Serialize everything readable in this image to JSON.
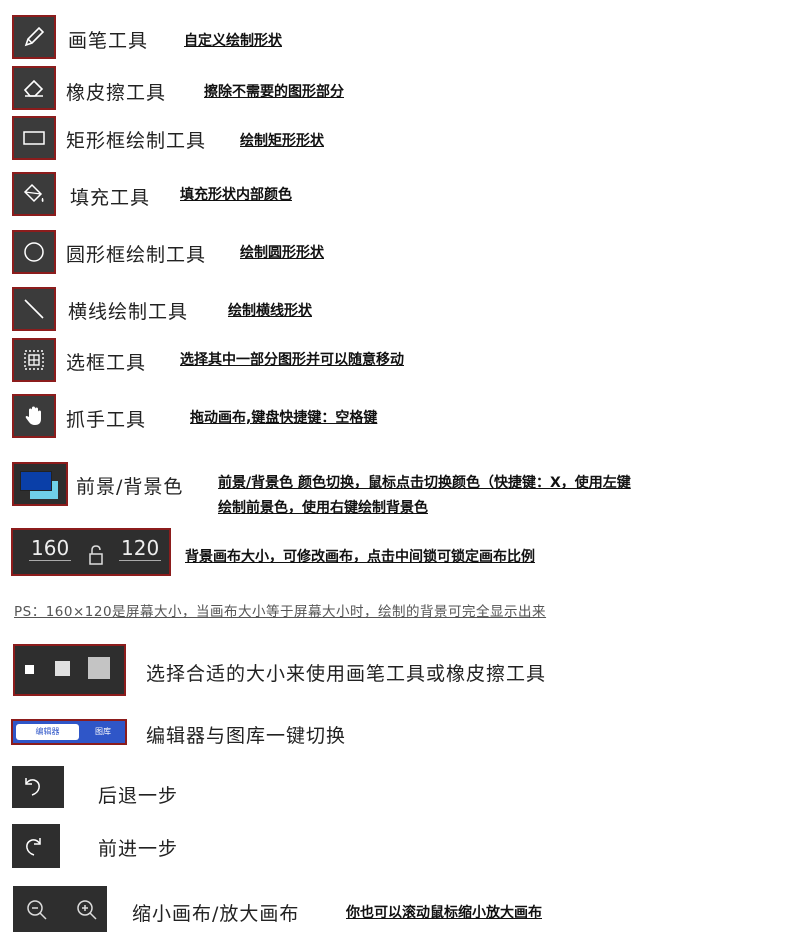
{
  "tools": [
    {
      "name": "画笔工具",
      "desc": "自定义绘制形状",
      "icon": "pencil-icon"
    },
    {
      "name": "橡皮擦工具",
      "desc": "擦除不需要的图形部分",
      "icon": "eraser-icon"
    },
    {
      "name": "矩形框绘制工具",
      "desc": "绘制矩形形状",
      "icon": "rectangle-icon"
    },
    {
      "name": "填充工具",
      "desc": "填充形状内部颜色",
      "icon": "paint-bucket-icon"
    },
    {
      "name": "圆形框绘制工具",
      "desc": "绘制圆形形状",
      "icon": "circle-icon"
    },
    {
      "name": "横线绘制工具",
      "desc": "绘制横线形状",
      "icon": "line-icon"
    },
    {
      "name": "选框工具",
      "desc": "选择其中一部分图形并可以随意移动",
      "icon": "marquee-select-icon"
    },
    {
      "name": "抓手工具",
      "desc": "拖动画布,键盘快捷键：空格键",
      "icon": "hand-icon"
    }
  ],
  "color_tool": {
    "name": "前景/背景色",
    "desc_line1": "前景/背景色 颜色切换，鼠标点击切换颜色（快捷键：X，使用左键",
    "desc_line2": "绘制前景色，使用右键绘制背景色",
    "foreground": "#0a3fa8",
    "background": "#6fd0e8"
  },
  "canvas_size": {
    "width": "160",
    "height": "120",
    "desc": "背景画布大小，可修改画布，点击中间锁可锁定画布比例"
  },
  "ps_note": "PS：160×120是屏幕大小，当画布大小等于屏幕大小时，绘制的背景可完全显示出来",
  "brush_size": {
    "desc": "选择合适的大小来使用画笔工具或橡皮擦工具"
  },
  "switcher": {
    "tab_editor": "编辑器",
    "tab_gallery": "图库",
    "desc": "编辑器与图库一键切换"
  },
  "undo": {
    "desc": "后退一步"
  },
  "redo": {
    "desc": "前进一步"
  },
  "zoom": {
    "name": "缩小画布/放大画布",
    "desc": "你也可以滚动鼠标缩小放大画布"
  },
  "colors": {
    "frame": "#8c1c1c",
    "icon_bg": "#3b3b3b"
  }
}
